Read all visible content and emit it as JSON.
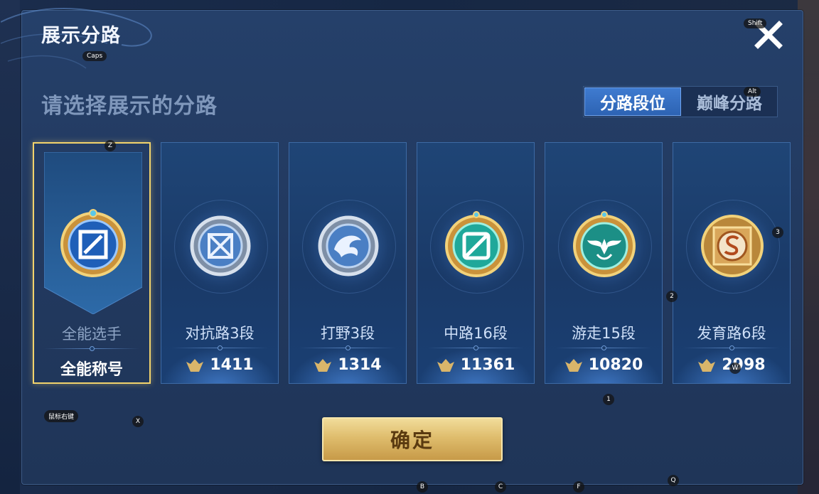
{
  "modal": {
    "title": "展示分路",
    "subtitle": "请选择展示的分路",
    "tabs": [
      {
        "label": "分路段位",
        "active": true
      },
      {
        "label": "巅峰分路",
        "active": false
      }
    ],
    "confirm_label": "确定"
  },
  "cards": [
    {
      "name": "全能选手",
      "score": "全能称号",
      "selected": true,
      "emblem": "all-round-emblem-icon"
    },
    {
      "name": "对抗路3段",
      "score": "1411",
      "emblem": "clash-lane-emblem-icon"
    },
    {
      "name": "打野3段",
      "score": "1314",
      "emblem": "jungle-dragon-emblem-icon"
    },
    {
      "name": "中路16段",
      "score": "11361",
      "emblem": "mid-lane-emblem-icon"
    },
    {
      "name": "游走15段",
      "score": "10820",
      "emblem": "roam-wings-emblem-icon"
    },
    {
      "name": "发育路6段",
      "score": "2998",
      "emblem": "farm-lane-emblem-icon"
    }
  ],
  "key_hints": {
    "shift": "Shift",
    "caps": "Caps",
    "alt": "Alt",
    "z": "Z",
    "three": "3",
    "two": "2",
    "one": "1",
    "w": "W",
    "mouse_right": "鼠标右键",
    "x": "X",
    "b": "B",
    "c": "C",
    "f": "F",
    "q": "Q"
  },
  "colors": {
    "accent_blue": "#2d63b3",
    "gold": "#f2d36c",
    "confirm_text": "#5a3a10"
  }
}
